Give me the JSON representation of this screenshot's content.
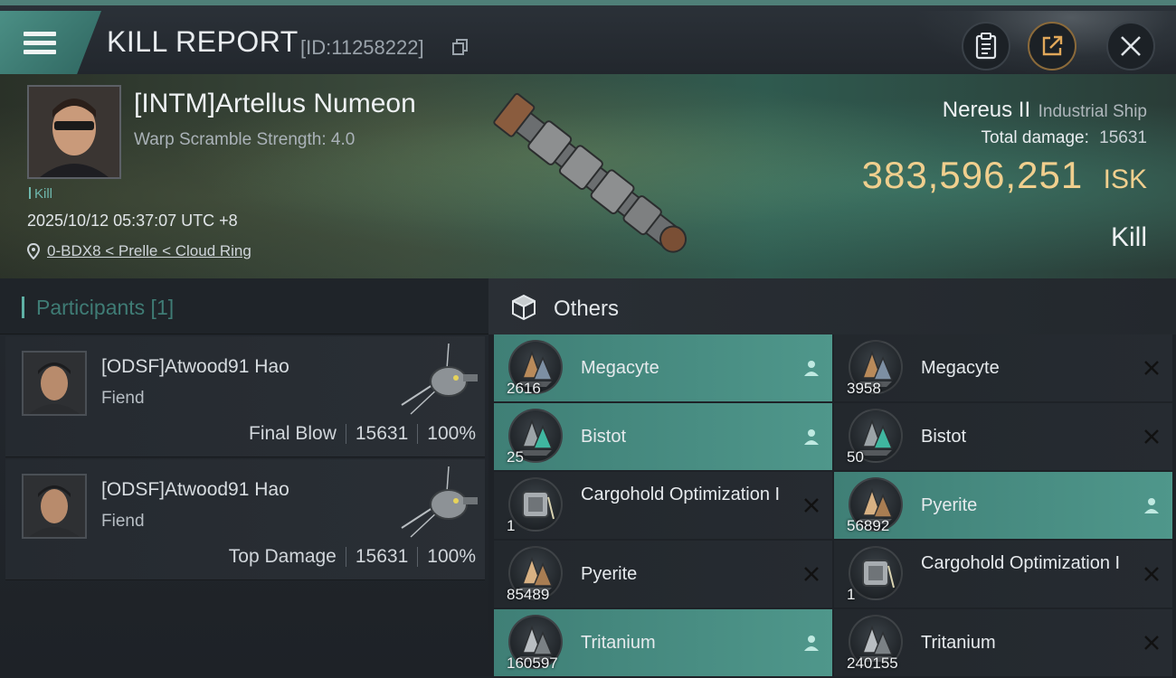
{
  "header": {
    "title": "KILL REPORT",
    "report_id": "[ID:11258222]"
  },
  "victim": {
    "name": "[INTM]Artellus Numeon",
    "warp_scramble": "Warp Scramble Strength: 4.0",
    "kill_tag": "Kill",
    "datetime": "2025/10/12 05:37:07 UTC +8",
    "location": "0-BDX8 < Prelle < Cloud Ring",
    "ship_name": "Nereus II",
    "ship_class": "Industrial Ship",
    "total_damage_label": "Total damage:",
    "total_damage": "15631",
    "isk_value": "383,596,251",
    "isk_unit": "ISK",
    "result": "Kill"
  },
  "participants": {
    "label": "Participants [1]",
    "list": [
      {
        "name": "[ODSF]Atwood91 Hao",
        "ship": "Fiend",
        "role": "Final Blow",
        "damage": "15631",
        "percent": "100%"
      },
      {
        "name": "[ODSF]Atwood91 Hao",
        "ship": "Fiend",
        "role": "Top Damage",
        "damage": "15631",
        "percent": "100%"
      }
    ]
  },
  "others": {
    "label": "Others",
    "items": [
      {
        "name": "Megacyte",
        "qty": "2616",
        "status": "dropped"
      },
      {
        "name": "Megacyte",
        "qty": "3958",
        "status": "destroyed"
      },
      {
        "name": "Bistot",
        "qty": "25",
        "status": "dropped"
      },
      {
        "name": "Bistot",
        "qty": "50",
        "status": "destroyed"
      },
      {
        "name": "Cargohold Optimization I",
        "qty": "1",
        "status": "destroyed"
      },
      {
        "name": "Pyerite",
        "qty": "56892",
        "status": "dropped"
      },
      {
        "name": "Pyerite",
        "qty": "85489",
        "status": "destroyed"
      },
      {
        "name": "Cargohold Optimization I",
        "qty": "1",
        "status": "destroyed"
      },
      {
        "name": "Tritanium",
        "qty": "160597",
        "status": "dropped"
      },
      {
        "name": "Tritanium",
        "qty": "240155",
        "status": "destroyed"
      }
    ]
  },
  "colors": {
    "accent_teal": "#4f978b",
    "isk_gold": "#f0cf8e",
    "panel_dark": "#1e2227"
  },
  "icons": [
    "menu-icon",
    "copy-icon",
    "clipboard-icon",
    "share-icon",
    "close-icon",
    "location-pin-icon",
    "cube-icon",
    "person-icon",
    "x-icon"
  ]
}
